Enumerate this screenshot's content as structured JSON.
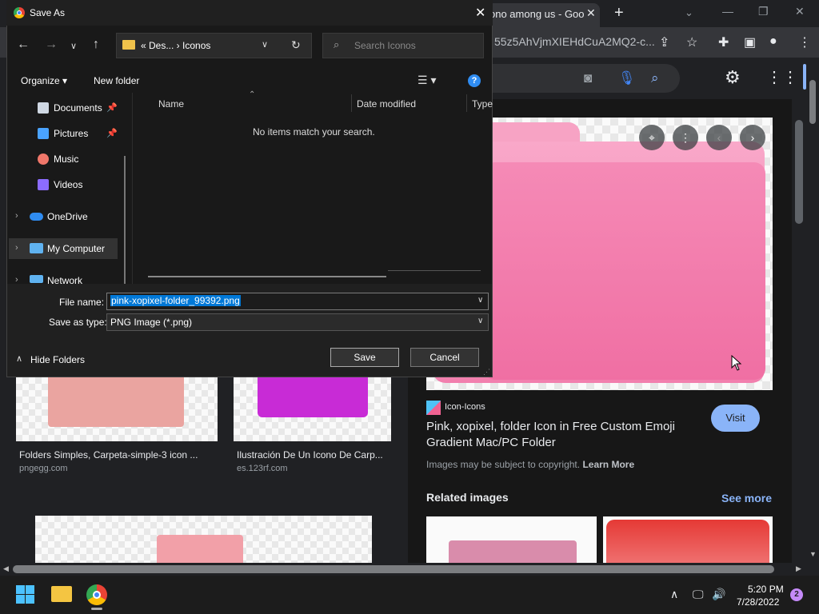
{
  "browser": {
    "tab_title": "ono among us - Goo",
    "tab_close": "✕",
    "new_tab": "+",
    "tab_search_icon": "⌄",
    "url": "55z5AhVjmXIEHdCuA2MQ2-c...",
    "window_controls": {
      "minimize": "—",
      "restore": "❐",
      "close": "✕"
    }
  },
  "google_search": {
    "camera_icon": "camera-icon",
    "mic_icon": "mic-icon",
    "search_icon": "search-icon"
  },
  "preview": {
    "source_name": "Icon-Icons",
    "title": "Pink, xopixel, folder Icon in Free Custom Emoji Gradient Mac/PC Folder",
    "visit_label": "Visit",
    "copyright_prefix": "Images may be subject to copyright.",
    "learn_more": "Learn More",
    "related_title": "Related images",
    "see_more": "See more"
  },
  "results": [
    {
      "caption": "Folders Simples, Carpeta-simple-3 icon ...",
      "source": "pngegg.com"
    },
    {
      "caption": "Ilustración De Un Icono De Carp...",
      "source": "es.123rf.com"
    }
  ],
  "dialog": {
    "title": "Save As",
    "close": "✕",
    "address": "« Des...  ›  Iconos",
    "search_placeholder": "Search Iconos",
    "organize": "Organize ▾",
    "new_folder": "New folder",
    "help": "?",
    "nav_items": [
      {
        "label": "Documents",
        "icon_color": "#cfd8e3"
      },
      {
        "label": "Pictures",
        "icon_color": "#4aa3ff"
      },
      {
        "label": "Music",
        "icon_color": "#f0776a"
      },
      {
        "label": "Videos",
        "icon_color": "#8c6cff"
      },
      {
        "label": "OneDrive",
        "icon_color": "#2f8cf1"
      },
      {
        "label": "My Computer",
        "icon_color": "#5fb2f0"
      },
      {
        "label": "Network",
        "icon_color": "#5fb2f0"
      }
    ],
    "columns": {
      "name": "Name",
      "date": "Date modified",
      "type": "Type"
    },
    "empty_message": "No items match your search.",
    "file_name_label": "File name:",
    "file_name_value": "pink-xopixel-folder_99392.png",
    "save_type_label": "Save as type:",
    "save_type_value": "PNG Image (*.png)",
    "hide_folders": "Hide Folders",
    "save": "Save",
    "cancel": "Cancel"
  },
  "taskbar": {
    "time": "5:20 PM",
    "date": "7/28/2022",
    "notifications": "2"
  },
  "colors": {
    "accent_blue": "#8ab4f8",
    "folder_pink": "#f58fb8",
    "selection": "#0078d7"
  }
}
